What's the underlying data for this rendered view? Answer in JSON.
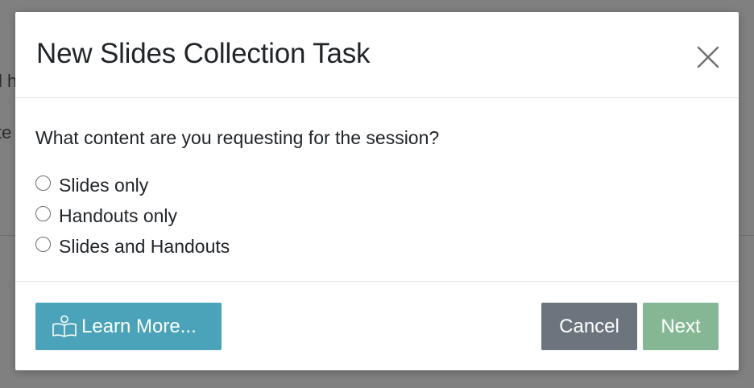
{
  "background": {
    "partial_text_1": "l h",
    "partial_text_2": "te"
  },
  "modal": {
    "title": "New Slides Collection Task",
    "close_icon": "close-icon",
    "question": "What content are you requesting for the session?",
    "options": [
      {
        "label": "Slides only",
        "selected": false
      },
      {
        "label": "Handouts only",
        "selected": false
      },
      {
        "label": "Slides and Handouts",
        "selected": false
      }
    ],
    "footer": {
      "learn_more_label": "Learn More...",
      "learn_more_icon": "book-reader-icon",
      "cancel_label": "Cancel",
      "next_label": "Next"
    }
  },
  "colors": {
    "backdrop": "#808080",
    "learn_more": "#4aa3b8",
    "cancel": "#6c757d",
    "next": "#85b795"
  }
}
